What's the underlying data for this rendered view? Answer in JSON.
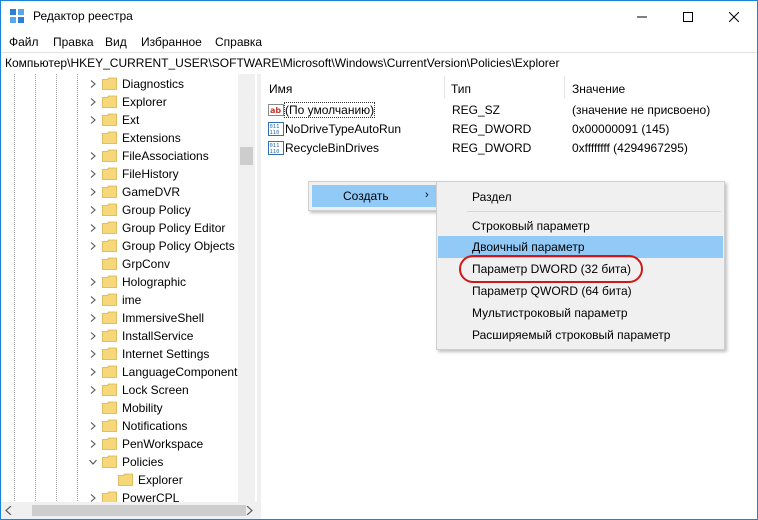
{
  "window": {
    "title": "Редактор реестра",
    "controls": {
      "minimize": "minimize",
      "maximize": "maximize",
      "close": "close"
    }
  },
  "menu": [
    "Файл",
    "Правка",
    "Вид",
    "Избранное",
    "Справка"
  ],
  "address": "Компьютер\\HKEY_CURRENT_USER\\SOFTWARE\\Microsoft\\Windows\\CurrentVersion\\Policies\\Explorer",
  "tree": [
    {
      "label": "Diagnostics",
      "expander": "right"
    },
    {
      "label": "Explorer",
      "expander": "right"
    },
    {
      "label": "Ext",
      "expander": "right"
    },
    {
      "label": "Extensions",
      "expander": "none"
    },
    {
      "label": "FileAssociations",
      "expander": "right"
    },
    {
      "label": "FileHistory",
      "expander": "right"
    },
    {
      "label": "GameDVR",
      "expander": "right"
    },
    {
      "label": "Group Policy",
      "expander": "right"
    },
    {
      "label": "Group Policy Editor",
      "expander": "right"
    },
    {
      "label": "Group Policy Objects",
      "expander": "right"
    },
    {
      "label": "GrpConv",
      "expander": "none"
    },
    {
      "label": "Holographic",
      "expander": "right"
    },
    {
      "label": "ime",
      "expander": "right"
    },
    {
      "label": "ImmersiveShell",
      "expander": "right"
    },
    {
      "label": "InstallService",
      "expander": "right"
    },
    {
      "label": "Internet Settings",
      "expander": "right"
    },
    {
      "label": "LanguageComponent",
      "expander": "right"
    },
    {
      "label": "Lock Screen",
      "expander": "right"
    },
    {
      "label": "Mobility",
      "expander": "none"
    },
    {
      "label": "Notifications",
      "expander": "right"
    },
    {
      "label": "PenWorkspace",
      "expander": "right"
    },
    {
      "label": "Policies",
      "expander": "down"
    },
    {
      "label": "Explorer",
      "expander": "none",
      "child": true,
      "selected": true
    },
    {
      "label": "PowerCPL",
      "expander": "right"
    }
  ],
  "list": {
    "headers": {
      "name": "Имя",
      "type": "Тип",
      "value": "Значение"
    },
    "rows": [
      {
        "icon": "string-value-icon",
        "name": "(По умолчанию)",
        "type": "REG_SZ",
        "value": "(значение не присвоено)",
        "focused": true
      },
      {
        "icon": "binary-value-icon",
        "name": "NoDriveTypeAutoRun",
        "type": "REG_DWORD",
        "value": "0x00000091 (145)"
      },
      {
        "icon": "binary-value-icon",
        "name": "RecycleBinDrives",
        "type": "REG_DWORD",
        "value": "0xffffffff (4294967295)"
      }
    ]
  },
  "context_menu": {
    "create_label": "Создать",
    "arrow": "›",
    "submenu": [
      "Раздел",
      "Строковый параметр",
      "Двоичный параметр",
      "Параметр DWORD (32 бита)",
      "Параметр QWORD (64 бита)",
      "Мультистроковый параметр",
      "Расширяемый строковый параметр"
    ]
  },
  "colors": {
    "accent": "#1883d7",
    "menu_highlight": "#91c9f7",
    "annotation_red": "#d01818",
    "folder": "#f6d77a"
  }
}
